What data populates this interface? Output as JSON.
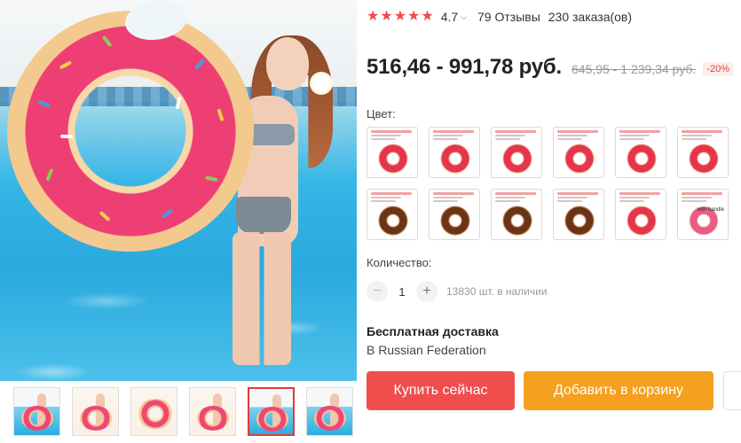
{
  "rating": {
    "stars": 5,
    "value": "4.7",
    "reviews": "79 Отзывы",
    "orders": "230 заказа(ов)"
  },
  "price": {
    "current": "516,46 - 991,78 руб.",
    "old": "645,95 - 1 239,34 руб.",
    "discount": "-20%"
  },
  "color_label": "Цвет:",
  "color_options": [
    {
      "variant": "pink"
    },
    {
      "variant": "pink"
    },
    {
      "variant": "pink"
    },
    {
      "variant": "pink"
    },
    {
      "variant": "pink"
    },
    {
      "variant": "pink"
    },
    {
      "variant": "brown"
    },
    {
      "variant": "brown"
    },
    {
      "variant": "brown"
    },
    {
      "variant": "brown"
    },
    {
      "variant": "pink"
    },
    {
      "variant": "light",
      "handle_text": "with handle"
    }
  ],
  "quantity": {
    "label": "Количество:",
    "minus": "−",
    "value": "1",
    "plus": "+",
    "stock": "13830 шт. в наличии"
  },
  "shipping": {
    "title": "Бесплатная доставка",
    "destination": "В Russian Federation"
  },
  "buttons": {
    "buy": "Купить сейчас",
    "cart": "Добавить в корзину"
  },
  "colors": {
    "accent_red": "#f04d4d",
    "cart_orange": "#f5a01e",
    "star": "#f04a4a"
  },
  "gallery": {
    "thumbnail_count": 6,
    "active_index": 4
  }
}
